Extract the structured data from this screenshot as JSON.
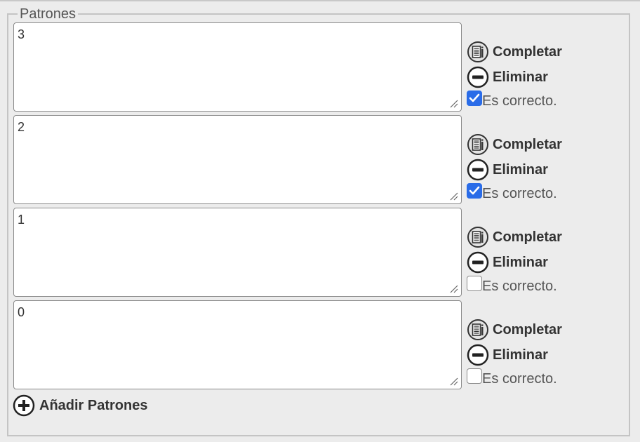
{
  "fieldset": {
    "legend": "Patrones"
  },
  "patterns": [
    {
      "value": "3",
      "checked": true
    },
    {
      "value": "2",
      "checked": true
    },
    {
      "value": "1",
      "checked": false
    },
    {
      "value": "0",
      "checked": false
    }
  ],
  "labels": {
    "complete": "Completar",
    "delete": "Eliminar",
    "correct": "Es correcto.",
    "add": "Añadir Patrones"
  },
  "icons": {
    "complete": "list-document-icon",
    "delete": "minus-circle-icon",
    "add": "plus-circle-icon",
    "check": "checkmark-icon"
  },
  "colors": {
    "checkbox_checked": "#2a6ce8",
    "background": "#ececec"
  }
}
